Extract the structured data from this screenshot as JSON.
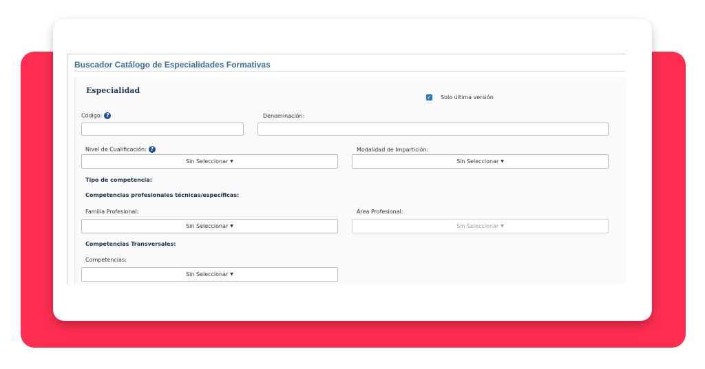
{
  "title": "Buscador Catálogo de Especialidades Formativas",
  "section": "Especialidad",
  "checkbox": {
    "label": "Solo última versión",
    "checked": true
  },
  "fields": {
    "codigo": "Código:",
    "denominacion": "Denominación:",
    "nivel": "Nivel de Cualificación:",
    "modalidad": "Modalidad de Impartición:",
    "familia": "Familia Profesional:",
    "area": "Área Profesional:",
    "competencias": "Competencias:"
  },
  "headings": {
    "tipo": "Tipo de competencia:",
    "tecnicas": "Competencias profesionales técnicas/específicas:",
    "transversales": "Competencias Transversales:"
  },
  "dropdown_placeholder": "Sin Seleccionar",
  "icons": {
    "help": "question-circle-icon",
    "caret": "caret-down-icon"
  },
  "colors": {
    "accent": "#ff2d51",
    "title": "#3d6ea3",
    "checkbox": "#3274c9"
  }
}
